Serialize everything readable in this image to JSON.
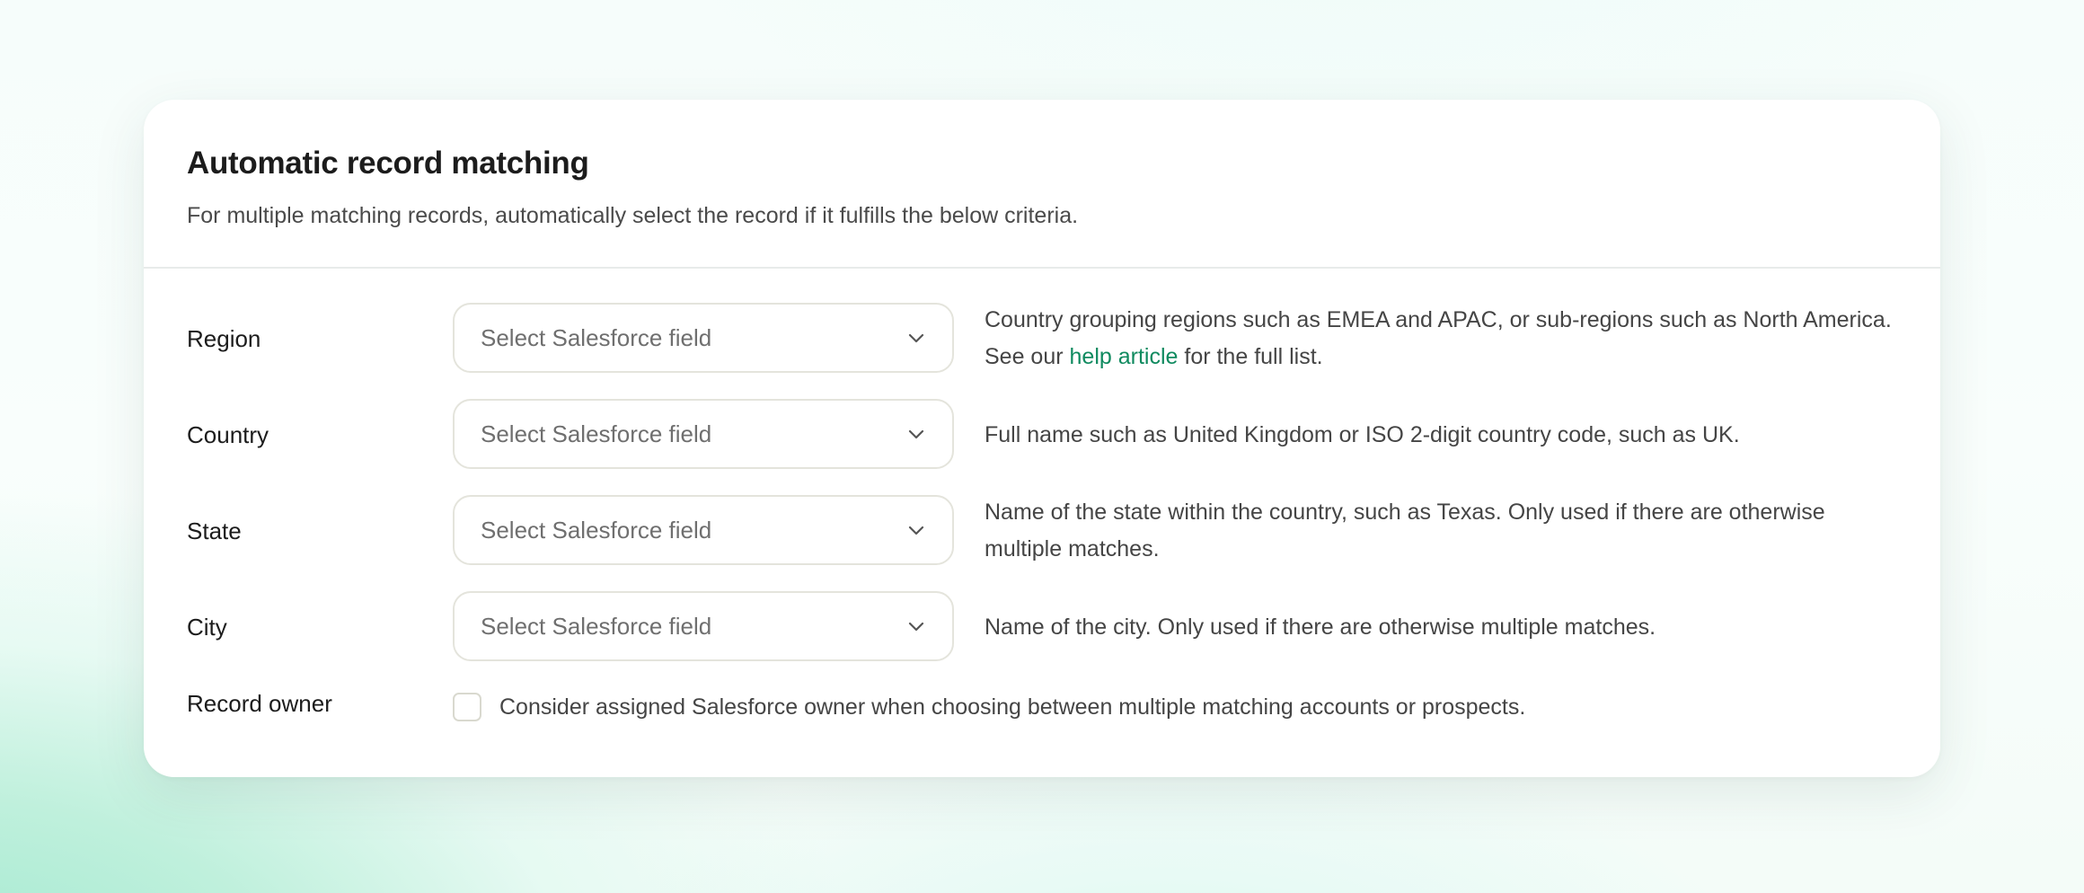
{
  "card": {
    "title": "Automatic record matching",
    "subtitle": "For multiple matching records, automatically select the record if it fulfills the below criteria."
  },
  "fields": [
    {
      "label": "Region",
      "select_placeholder": "Select Salesforce field",
      "description_before": "Country grouping regions such as EMEA and APAC, or sub-regions such as North America. See our ",
      "description_link": "help article",
      "description_after": " for the full list."
    },
    {
      "label": "Country",
      "select_placeholder": "Select Salesforce field",
      "description": "Full name such as United Kingdom or ISO 2-digit country code, such as UK."
    },
    {
      "label": "State",
      "select_placeholder": "Select Salesforce field",
      "description": "Name of the state within the country, such as Texas. Only used if there are otherwise multiple matches."
    },
    {
      "label": "City",
      "select_placeholder": "Select Salesforce field",
      "description": "Name of the city. Only used if there are otherwise multiple matches."
    }
  ],
  "record_owner": {
    "label": "Record owner",
    "checkbox_label": "Consider assigned Salesforce owner when choosing between multiple matching accounts or prospects.",
    "checked": false
  },
  "colors": {
    "link": "#0f8a5f",
    "title": "#1c1c1c",
    "text": "#454545",
    "placeholder": "#6f6f6f"
  },
  "icons": {
    "select_chevron": "chevron-down-icon"
  }
}
